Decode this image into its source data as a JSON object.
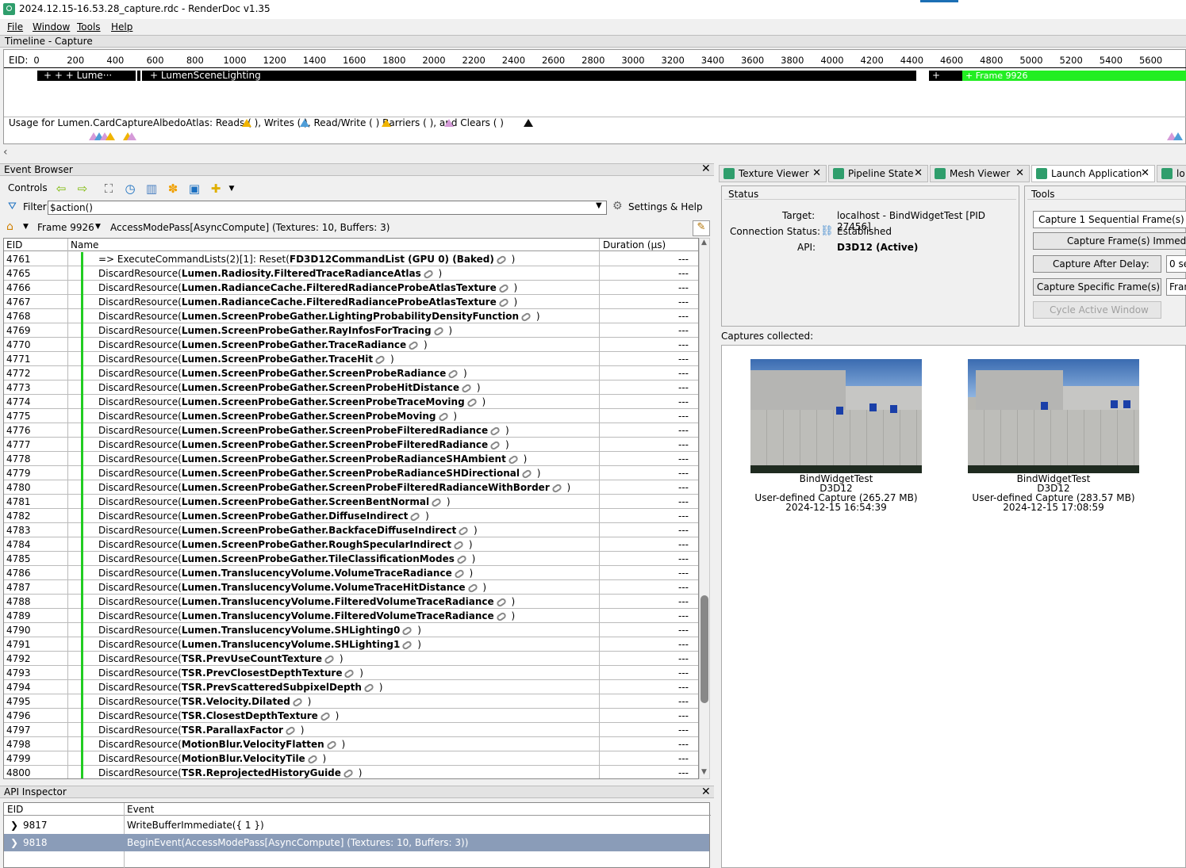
{
  "window": {
    "title": "2024.12.15-16.53.28_capture.rdc - RenderDoc v1.35"
  },
  "menu": [
    "File",
    "Window",
    "Tools",
    "Help"
  ],
  "timeline": {
    "title": "Timeline - Capture",
    "eid_label": "EID:",
    "ticks": [
      "0",
      "200",
      "400",
      "600",
      "800",
      "1000",
      "1200",
      "1400",
      "1600",
      "1800",
      "2000",
      "2200",
      "2400",
      "2600",
      "2800",
      "3000",
      "3200",
      "3400",
      "3600",
      "3800",
      "4000",
      "4200",
      "4400",
      "4600",
      "4800",
      "5000",
      "5200",
      "5400",
      "5600",
      "5"
    ],
    "bar_text_1": "+     +     + Lume···",
    "bar_text_2": "+ LumenSceneLighting",
    "bar_text_3": "+",
    "bar_text_green": "+ Frame 9926",
    "usage_text": "Usage for Lumen.CardCaptureAlbedoAtlas: Reads (   ), Writes (   ), Read/Write (   ) Barriers (   ), and Clears (   )"
  },
  "event_browser": {
    "title": "Event Browser",
    "controls_label": "Controls",
    "filter_label": "Filter",
    "filter_value": "$action()",
    "settings_label": "Settings & Help",
    "frame_label": "Frame 9926",
    "current_marker": "AccessModePass[AsyncCompute] (Textures: 10, Buffers: 3)",
    "columns": {
      "eid": "EID",
      "name": "Name",
      "duration": "Duration (µs)"
    },
    "rows": [
      {
        "eid": "4761",
        "pre": "=> ExecuteCommandLists(2)[1]: Reset(",
        "bold": "FD3D12CommandList (GPU 0) (Baked)",
        "post": " )",
        "dur": "---",
        "indent": 0
      },
      {
        "eid": "4765",
        "pre": "DiscardResource(",
        "bold": "Lumen.Radiosity.FilteredTraceRadianceAtlas",
        "post": " )",
        "dur": "---",
        "indent": 1
      },
      {
        "eid": "4766",
        "pre": "DiscardResource(",
        "bold": "Lumen.RadianceCache.FilteredRadianceProbeAtlasTexture",
        "post": " )",
        "dur": "---",
        "indent": 1
      },
      {
        "eid": "4767",
        "pre": "DiscardResource(",
        "bold": "Lumen.RadianceCache.FilteredRadianceProbeAtlasTexture",
        "post": " )",
        "dur": "---",
        "indent": 1
      },
      {
        "eid": "4768",
        "pre": "DiscardResource(",
        "bold": "Lumen.ScreenProbeGather.LightingProbabilityDensityFunction",
        "post": " )",
        "dur": "---",
        "indent": 1
      },
      {
        "eid": "4769",
        "pre": "DiscardResource(",
        "bold": "Lumen.ScreenProbeGather.RayInfosForTracing",
        "post": " )",
        "dur": "---",
        "indent": 1
      },
      {
        "eid": "4770",
        "pre": "DiscardResource(",
        "bold": "Lumen.ScreenProbeGather.TraceRadiance",
        "post": " )",
        "dur": "---",
        "indent": 1
      },
      {
        "eid": "4771",
        "pre": "DiscardResource(",
        "bold": "Lumen.ScreenProbeGather.TraceHit",
        "post": " )",
        "dur": "---",
        "indent": 1
      },
      {
        "eid": "4772",
        "pre": "DiscardResource(",
        "bold": "Lumen.ScreenProbeGather.ScreenProbeRadiance",
        "post": " )",
        "dur": "---",
        "indent": 1
      },
      {
        "eid": "4773",
        "pre": "DiscardResource(",
        "bold": "Lumen.ScreenProbeGather.ScreenProbeHitDistance",
        "post": " )",
        "dur": "---",
        "indent": 1
      },
      {
        "eid": "4774",
        "pre": "DiscardResource(",
        "bold": "Lumen.ScreenProbeGather.ScreenProbeTraceMoving",
        "post": " )",
        "dur": "---",
        "indent": 1
      },
      {
        "eid": "4775",
        "pre": "DiscardResource(",
        "bold": "Lumen.ScreenProbeGather.ScreenProbeMoving",
        "post": " )",
        "dur": "---",
        "indent": 1
      },
      {
        "eid": "4776",
        "pre": "DiscardResource(",
        "bold": "Lumen.ScreenProbeGather.ScreenProbeFilteredRadiance",
        "post": " )",
        "dur": "---",
        "indent": 1
      },
      {
        "eid": "4777",
        "pre": "DiscardResource(",
        "bold": "Lumen.ScreenProbeGather.ScreenProbeFilteredRadiance",
        "post": " )",
        "dur": "---",
        "indent": 1
      },
      {
        "eid": "4778",
        "pre": "DiscardResource(",
        "bold": "Lumen.ScreenProbeGather.ScreenProbeRadianceSHAmbient",
        "post": " )",
        "dur": "---",
        "indent": 1
      },
      {
        "eid": "4779",
        "pre": "DiscardResource(",
        "bold": "Lumen.ScreenProbeGather.ScreenProbeRadianceSHDirectional",
        "post": " )",
        "dur": "---",
        "indent": 1
      },
      {
        "eid": "4780",
        "pre": "DiscardResource(",
        "bold": "Lumen.ScreenProbeGather.ScreenProbeFilteredRadianceWithBorder",
        "post": " )",
        "dur": "---",
        "indent": 1
      },
      {
        "eid": "4781",
        "pre": "DiscardResource(",
        "bold": "Lumen.ScreenProbeGather.ScreenBentNormal",
        "post": " )",
        "dur": "---",
        "indent": 1
      },
      {
        "eid": "4782",
        "pre": "DiscardResource(",
        "bold": "Lumen.ScreenProbeGather.DiffuseIndirect",
        "post": " )",
        "dur": "---",
        "indent": 1
      },
      {
        "eid": "4783",
        "pre": "DiscardResource(",
        "bold": "Lumen.ScreenProbeGather.BackfaceDiffuseIndirect",
        "post": " )",
        "dur": "---",
        "indent": 1
      },
      {
        "eid": "4784",
        "pre": "DiscardResource(",
        "bold": "Lumen.ScreenProbeGather.RoughSpecularIndirect",
        "post": " )",
        "dur": "---",
        "indent": 1
      },
      {
        "eid": "4785",
        "pre": "DiscardResource(",
        "bold": "Lumen.ScreenProbeGather.TileClassificationModes",
        "post": " )",
        "dur": "---",
        "indent": 1
      },
      {
        "eid": "4786",
        "pre": "DiscardResource(",
        "bold": "Lumen.TranslucencyVolume.VolumeTraceRadiance",
        "post": " )",
        "dur": "---",
        "indent": 1
      },
      {
        "eid": "4787",
        "pre": "DiscardResource(",
        "bold": "Lumen.TranslucencyVolume.VolumeTraceHitDistance",
        "post": " )",
        "dur": "---",
        "indent": 1
      },
      {
        "eid": "4788",
        "pre": "DiscardResource(",
        "bold": "Lumen.TranslucencyVolume.FilteredVolumeTraceRadiance",
        "post": " )",
        "dur": "---",
        "indent": 1
      },
      {
        "eid": "4789",
        "pre": "DiscardResource(",
        "bold": "Lumen.TranslucencyVolume.FilteredVolumeTraceRadiance",
        "post": " )",
        "dur": "---",
        "indent": 1
      },
      {
        "eid": "4790",
        "pre": "DiscardResource(",
        "bold": "Lumen.TranslucencyVolume.SHLighting0",
        "post": " )",
        "dur": "---",
        "indent": 1
      },
      {
        "eid": "4791",
        "pre": "DiscardResource(",
        "bold": "Lumen.TranslucencyVolume.SHLighting1",
        "post": " )",
        "dur": "---",
        "indent": 1
      },
      {
        "eid": "4792",
        "pre": "DiscardResource(",
        "bold": "TSR.PrevUseCountTexture",
        "post": " )",
        "dur": "---",
        "indent": 1
      },
      {
        "eid": "4793",
        "pre": "DiscardResource(",
        "bold": "TSR.PrevClosestDepthTexture",
        "post": " )",
        "dur": "---",
        "indent": 1
      },
      {
        "eid": "4794",
        "pre": "DiscardResource(",
        "bold": "TSR.PrevScatteredSubpixelDepth",
        "post": " )",
        "dur": "---",
        "indent": 1
      },
      {
        "eid": "4795",
        "pre": "DiscardResource(",
        "bold": "TSR.Velocity.Dilated",
        "post": " )",
        "dur": "---",
        "indent": 1
      },
      {
        "eid": "4796",
        "pre": "DiscardResource(",
        "bold": "TSR.ClosestDepthTexture",
        "post": " )",
        "dur": "---",
        "indent": 1
      },
      {
        "eid": "4797",
        "pre": "DiscardResource(",
        "bold": "TSR.ParallaxFactor",
        "post": " )",
        "dur": "---",
        "indent": 1
      },
      {
        "eid": "4798",
        "pre": "DiscardResource(",
        "bold": "MotionBlur.VelocityFlatten",
        "post": " )",
        "dur": "---",
        "indent": 1
      },
      {
        "eid": "4799",
        "pre": "DiscardResource(",
        "bold": "MotionBlur.VelocityTile",
        "post": " )",
        "dur": "---",
        "indent": 1
      },
      {
        "eid": "4800",
        "pre": "DiscardResource(",
        "bold": "TSR.ReprojectedHistoryGuide",
        "post": " )",
        "dur": "---",
        "indent": 1
      }
    ]
  },
  "api_inspector": {
    "title": "API Inspector",
    "columns": {
      "eid": "EID",
      "event": "Event"
    },
    "rows": [
      {
        "eid": "9817",
        "event": "WriteBufferImmediate({ 1 })",
        "selected": false
      },
      {
        "eid": "9818",
        "event": "BeginEvent(AccessModePass[AsyncCompute] (Textures: 10, Buffers: 3))",
        "selected": true
      }
    ]
  },
  "right_tabs": [
    "Texture Viewer",
    "Pipeline State",
    "Mesh Viewer",
    "Launch Application",
    "lo"
  ],
  "status": {
    "title": "Status",
    "target_label": "Target:",
    "target_value": "localhost - BindWidgetTest [PID 27456]",
    "conn_label": "Connection Status:",
    "conn_value": "Established",
    "api_label": "API:",
    "api_value": "D3D12 (Active)"
  },
  "tools": {
    "title": "Tools",
    "capture_count": "Capture 1 Sequential Frame(s)",
    "capture_immediate": "Capture Frame(s) Immediately",
    "capture_delay": "Capture After Delay:",
    "delay_value": "0 se",
    "capture_specific": "Capture Specific Frame(s):",
    "specific_value": "Fran",
    "cycle": "Cycle Active Window"
  },
  "captures": {
    "label": "Captures collected:",
    "items": [
      {
        "name": "BindWidgetTest",
        "api": "D3D12",
        "desc": "User-defined Capture (265.27 MB)",
        "time": "2024-12-15 16:54:39"
      },
      {
        "name": "BindWidgetTest",
        "api": "D3D12",
        "desc": "User-defined Capture (283.57 MB)",
        "time": "2024-12-15 17:08:59"
      }
    ]
  },
  "colors": {
    "accent_green": "#22ee22",
    "selection": "#8a9cb8",
    "app_icon": "#2f9e6c"
  }
}
